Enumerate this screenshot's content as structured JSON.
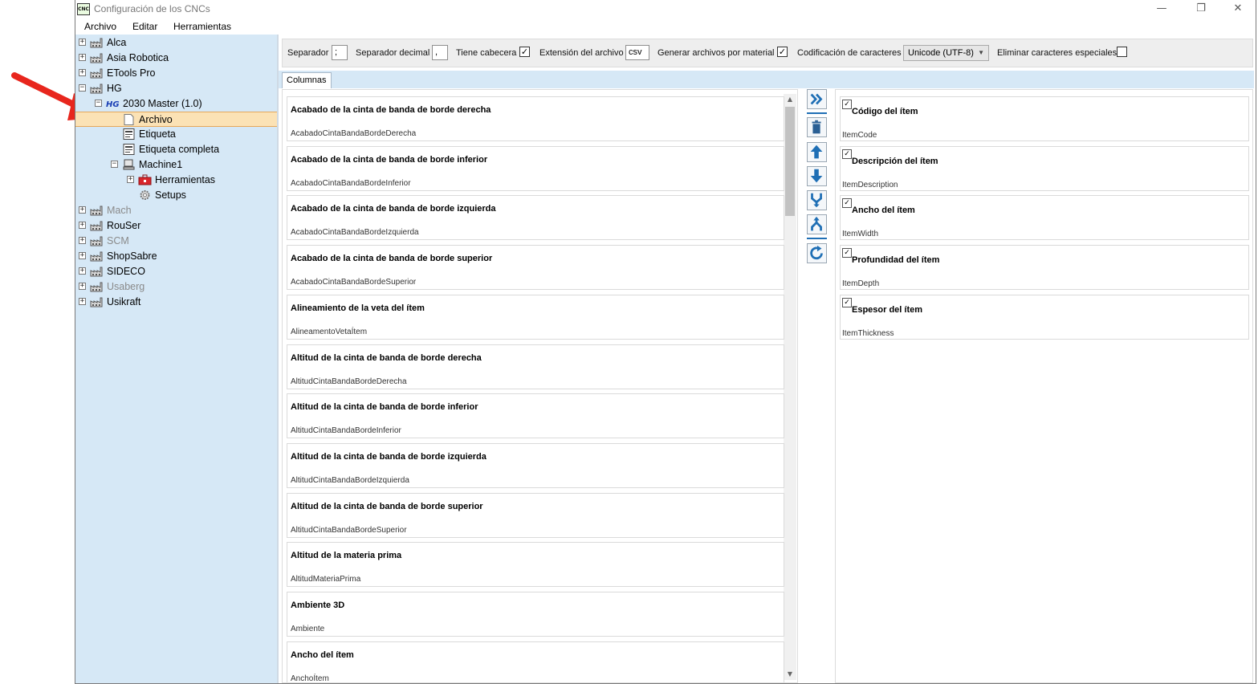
{
  "window": {
    "title": "Configuración de los CNCs",
    "app_icon_text": "CNC",
    "controls": {
      "minimize": "—",
      "restore": "❐",
      "close": "✕"
    }
  },
  "menu": [
    "Archivo",
    "Editar",
    "Herramientas"
  ],
  "tree": {
    "items": [
      {
        "label": "Alca",
        "expander": "+",
        "icon": "factory-icon",
        "disabled": false
      },
      {
        "label": "Asia Robotica",
        "expander": "+",
        "icon": "factory-icon",
        "disabled": false
      },
      {
        "label": "ETools Pro",
        "expander": "+",
        "icon": "factory-icon",
        "disabled": false
      },
      {
        "label": "HG",
        "expander": "−",
        "icon": "factory-icon",
        "disabled": false
      },
      {
        "label": "2030 Master (1.0)",
        "expander": "−",
        "icon": "hg-logo-icon",
        "icon_text": "HG",
        "disabled": false
      },
      {
        "label": "Archivo",
        "expander": "",
        "icon": "file-icon",
        "disabled": false,
        "selected": true
      },
      {
        "label": "Etiqueta",
        "expander": "",
        "icon": "label-icon",
        "disabled": false
      },
      {
        "label": "Etiqueta completa",
        "expander": "",
        "icon": "label-icon",
        "disabled": false
      },
      {
        "label": "Machine1",
        "expander": "−",
        "icon": "machine-icon",
        "disabled": false
      },
      {
        "label": "Herramientas",
        "expander": "+",
        "icon": "toolbox-icon",
        "disabled": false
      },
      {
        "label": "Setups",
        "expander": "",
        "icon": "gear-icon",
        "disabled": false
      },
      {
        "label": "Mach",
        "expander": "+",
        "icon": "factory-icon",
        "disabled": true
      },
      {
        "label": "RouSer",
        "expander": "+",
        "icon": "factory-icon",
        "disabled": false
      },
      {
        "label": "SCM",
        "expander": "+",
        "icon": "factory-icon",
        "disabled": true
      },
      {
        "label": "ShopSabre",
        "expander": "+",
        "icon": "factory-icon",
        "disabled": false
      },
      {
        "label": "SIDECO",
        "expander": "+",
        "icon": "factory-icon",
        "disabled": false
      },
      {
        "label": "Usaberg",
        "expander": "+",
        "icon": "factory-icon",
        "disabled": true
      },
      {
        "label": "Usikraft",
        "expander": "+",
        "icon": "factory-icon",
        "disabled": false
      }
    ]
  },
  "toolbar": {
    "separator_label": "Separador",
    "separator_value": ";",
    "decimal_label": "Separador decimal",
    "decimal_value": ",",
    "header_label": "Tiene cabecera",
    "header_checked": "✓",
    "extension_label": "Extensión del archivo",
    "extension_value": "csv",
    "per_material_label": "Generar archivos por material",
    "per_material_checked": "✓",
    "encoding_label": "Codificación de caracteres",
    "encoding_value": "Unicode (UTF-8)",
    "remove_special_label": "Eliminar caracteres especiales",
    "remove_special_checked": ""
  },
  "tabs": [
    "Columnas"
  ],
  "available_columns": [
    {
      "title": "Acabado de la cinta de banda de borde derecha",
      "key": "AcabadoCintaBandaBordeDerecha"
    },
    {
      "title": "Acabado de la cinta de banda de borde inferior",
      "key": "AcabadoCintaBandaBordeInferior"
    },
    {
      "title": "Acabado de la cinta de banda de borde izquierda",
      "key": "AcabadoCintaBandaBordeIzquierda"
    },
    {
      "title": "Acabado de la cinta de banda de borde superior",
      "key": "AcabadoCintaBandaBordeSuperior"
    },
    {
      "title": "Alineamiento de la veta del ítem",
      "key": "AlineamentoVetaÍtem"
    },
    {
      "title": "Altitud de la cinta de banda de borde derecha",
      "key": "AltitudCintaBandaBordeDerecha"
    },
    {
      "title": "Altitud de la cinta de banda de borde inferior",
      "key": "AltitudCintaBandaBordeInferior"
    },
    {
      "title": "Altitud de la cinta de banda de borde izquierda",
      "key": "AltitudCintaBandaBordeIzquierda"
    },
    {
      "title": "Altitud de la cinta de banda de borde superior",
      "key": "AltitudCintaBandaBordeSuperior"
    },
    {
      "title": "Altitud de la materia prima",
      "key": "AltitudMateriaPrima"
    },
    {
      "title": "Ambiente 3D",
      "key": "Ambiente"
    },
    {
      "title": "Ancho del ítem",
      "key": "AnchoÍtem"
    }
  ],
  "actions": [
    {
      "name": "add-column-icon",
      "glyph": "»"
    },
    {
      "name": "delete-icon",
      "glyph": "🗑"
    },
    {
      "name": "move-up-icon",
      "glyph": "↑"
    },
    {
      "name": "move-down-icon",
      "glyph": "↓"
    },
    {
      "name": "merge-icon",
      "glyph": "⑂"
    },
    {
      "name": "split-icon",
      "glyph": "⑃"
    },
    {
      "name": "refresh-icon",
      "glyph": "⟳"
    }
  ],
  "selected_columns": [
    {
      "title": "Código del ítem",
      "key": "ItemCode",
      "checked": "✓"
    },
    {
      "title": "Descripción del ítem",
      "key": "ItemDescription",
      "checked": "✓"
    },
    {
      "title": "Ancho del ítem",
      "key": "ItemWidth",
      "checked": "✓"
    },
    {
      "title": "Profundidad del ítem",
      "key": "ItemDepth",
      "checked": "✓"
    },
    {
      "title": "Espesor del ítem",
      "key": "ItemThickness",
      "checked": "✓"
    }
  ],
  "colors": {
    "tree_bg": "#d6e8f6",
    "selection_bg": "#fbe2b5",
    "accent_blue": "#1f6fb5",
    "arrow_red": "#e8261d"
  }
}
